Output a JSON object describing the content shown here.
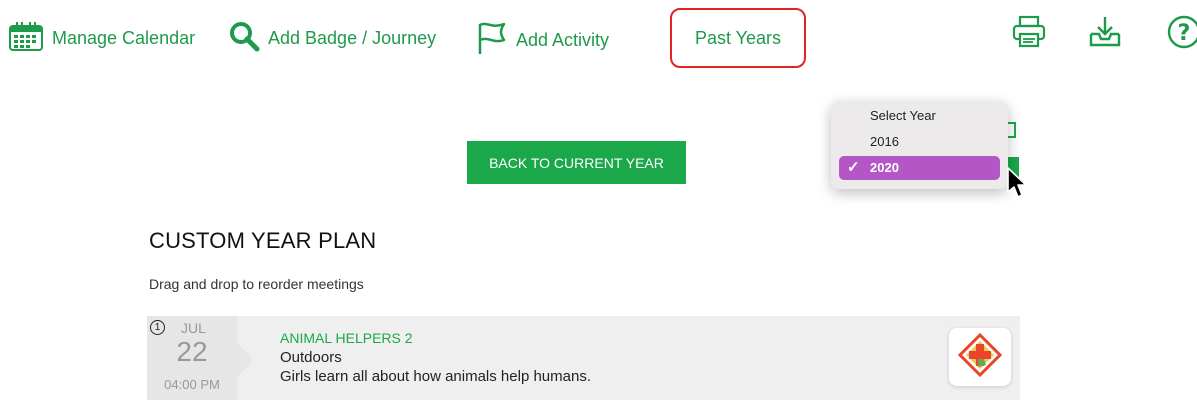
{
  "toolbar": {
    "manage_calendar": "Manage Calendar",
    "add_badge": "Add Badge / Journey",
    "add_activity": "Add Activity",
    "past_years": "Past Years"
  },
  "year_dropdown": {
    "options": [
      "Select Year",
      "2016",
      "2020"
    ],
    "selected": "2020"
  },
  "back_button": "BACK TO CURRENT YEAR",
  "page": {
    "title": "CUSTOM YEAR PLAN",
    "subtitle": "Drag and drop to reorder meetings"
  },
  "meeting": {
    "number": "1",
    "month": "JUL",
    "day": "22",
    "time": "04:00 PM",
    "title": "ANIMAL HELPERS 2",
    "category": "Outdoors",
    "description": "Girls learn all about how animals help humans."
  },
  "colors": {
    "accent_green": "#1aa84b",
    "highlight_red": "#e02424",
    "selected_purple": "#b556c6"
  },
  "icons": [
    "calendar-icon",
    "search-icon",
    "flag-icon",
    "printer-icon",
    "download-icon",
    "help-icon",
    "checkmark-icon",
    "cursor-icon",
    "badge-icon"
  ]
}
